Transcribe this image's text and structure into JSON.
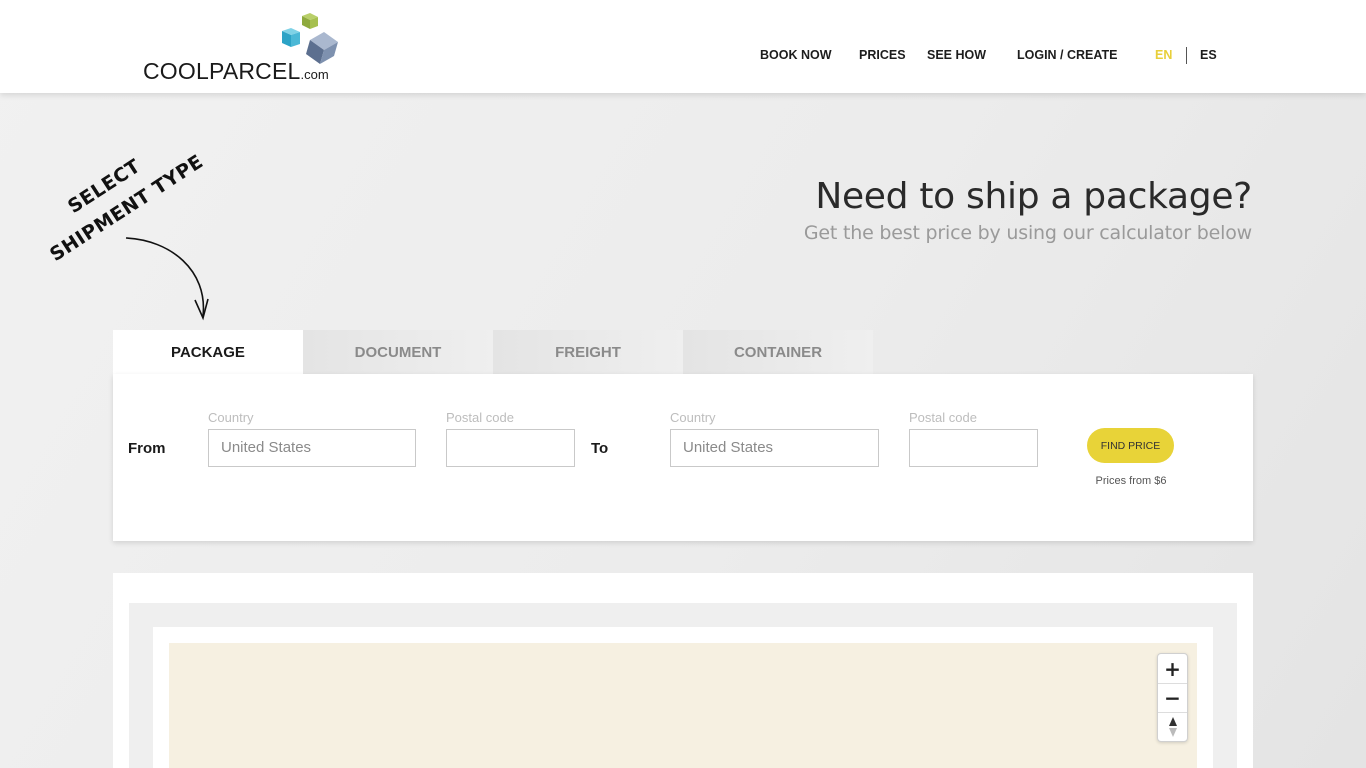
{
  "header": {
    "logo_text": "COOLPARCEL",
    "logo_suffix": ".com",
    "nav": {
      "book_now": "BOOK NOW",
      "prices": "PRICES",
      "see_how": "SEE HOW",
      "login": "LOGIN / CREATE",
      "lang_en": "EN",
      "lang_es": "ES"
    },
    "active_lang_color": "#e8cf3a"
  },
  "annotation": {
    "line1": "SELECT",
    "line2": "SHIPMENT TYPE"
  },
  "hero": {
    "title": "Need to ship a package?",
    "subtitle": "Get the best price by using our calculator below"
  },
  "tabs": [
    {
      "label": "PACKAGE",
      "active": true
    },
    {
      "label": "DOCUMENT",
      "active": false
    },
    {
      "label": "FREIGHT",
      "active": false
    },
    {
      "label": "CONTAINER",
      "active": false
    }
  ],
  "form": {
    "from_label": "From",
    "to_label": "To",
    "from_country_label": "Country",
    "from_country_value": "United States",
    "from_postal_label": "Postal code",
    "from_postal_value": "",
    "to_country_label": "Country",
    "to_country_value": "United States",
    "to_postal_label": "Postal code",
    "to_postal_value": "",
    "find_button": "FIND PRICE",
    "prices_from": "Prices from $6",
    "button_color": "#e8d338"
  },
  "map": {
    "zoom_in": "+",
    "zoom_out": "−",
    "background_color": "#f6f0e1"
  }
}
